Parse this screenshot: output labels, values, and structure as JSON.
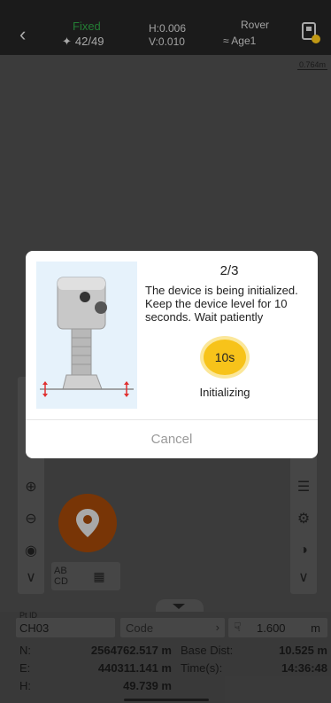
{
  "status_bar": {
    "fix_status": "Fixed",
    "satellites": "42/49",
    "h_precision": "H:0.006",
    "v_precision": "V:0.010",
    "mode": "Rover",
    "age": "Age1",
    "fix_color": "#2ea043"
  },
  "map": {
    "scale_label": "0.764m"
  },
  "dialog": {
    "step": "2/3",
    "message": "The device is being initialized. Keep the device level for 10 seconds. Wait patiently",
    "countdown": "10s",
    "status": "Initializing",
    "cancel_label": "Cancel",
    "timer_color": "#f7c31a"
  },
  "fields": {
    "point_id_label": "Pt ID",
    "point_id": "CH03",
    "code_placeholder": "Code",
    "antenna_height": "1.600",
    "antenna_unit": "m"
  },
  "coordinates": {
    "north_label": "N:",
    "north_value": "2564762.517 m",
    "east_label": "E:",
    "east_value": "440311.141 m",
    "height_label": "H:",
    "height_value": "49.739 m",
    "base_dist_label": "Base Dist:",
    "base_dist_value": "10.525 m",
    "time_label": "Time(s):",
    "time_value": "14:36:48"
  },
  "mini_tools": {
    "ab_label": "AB CD"
  }
}
